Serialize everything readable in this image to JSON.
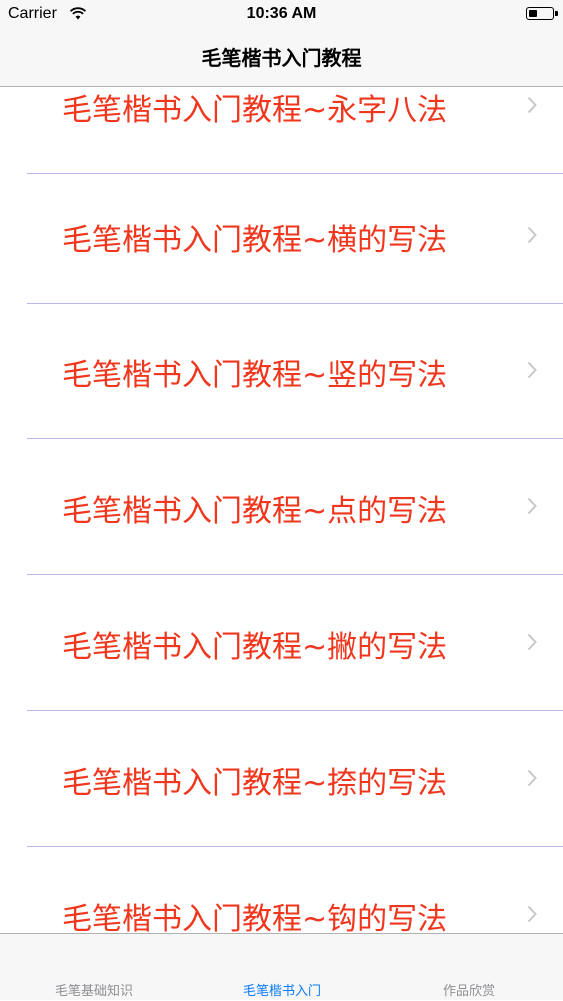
{
  "status_bar": {
    "carrier": "Carrier",
    "time": "10:36 AM"
  },
  "nav": {
    "title": "毛笔楷书入门教程"
  },
  "list": {
    "items": [
      {
        "label": "毛笔楷书入门教程~永字八法"
      },
      {
        "label": "毛笔楷书入门教程~横的写法"
      },
      {
        "label": "毛笔楷书入门教程~竖的写法"
      },
      {
        "label": "毛笔楷书入门教程~点的写法"
      },
      {
        "label": "毛笔楷书入门教程~撇的写法"
      },
      {
        "label": "毛笔楷书入门教程~捺的写法"
      },
      {
        "label": "毛笔楷书入门教程~钩的写法"
      }
    ]
  },
  "tab_bar": {
    "tabs": [
      {
        "label": "毛笔基础知识",
        "active": false
      },
      {
        "label": "毛笔楷书入门",
        "active": true
      },
      {
        "label": "作品欣赏",
        "active": false
      }
    ]
  },
  "colors": {
    "item_text": "#f0371e",
    "active_tab": "#0a7aff",
    "inactive_tab": "#8e8e93",
    "separator": "#b8b8ee"
  }
}
